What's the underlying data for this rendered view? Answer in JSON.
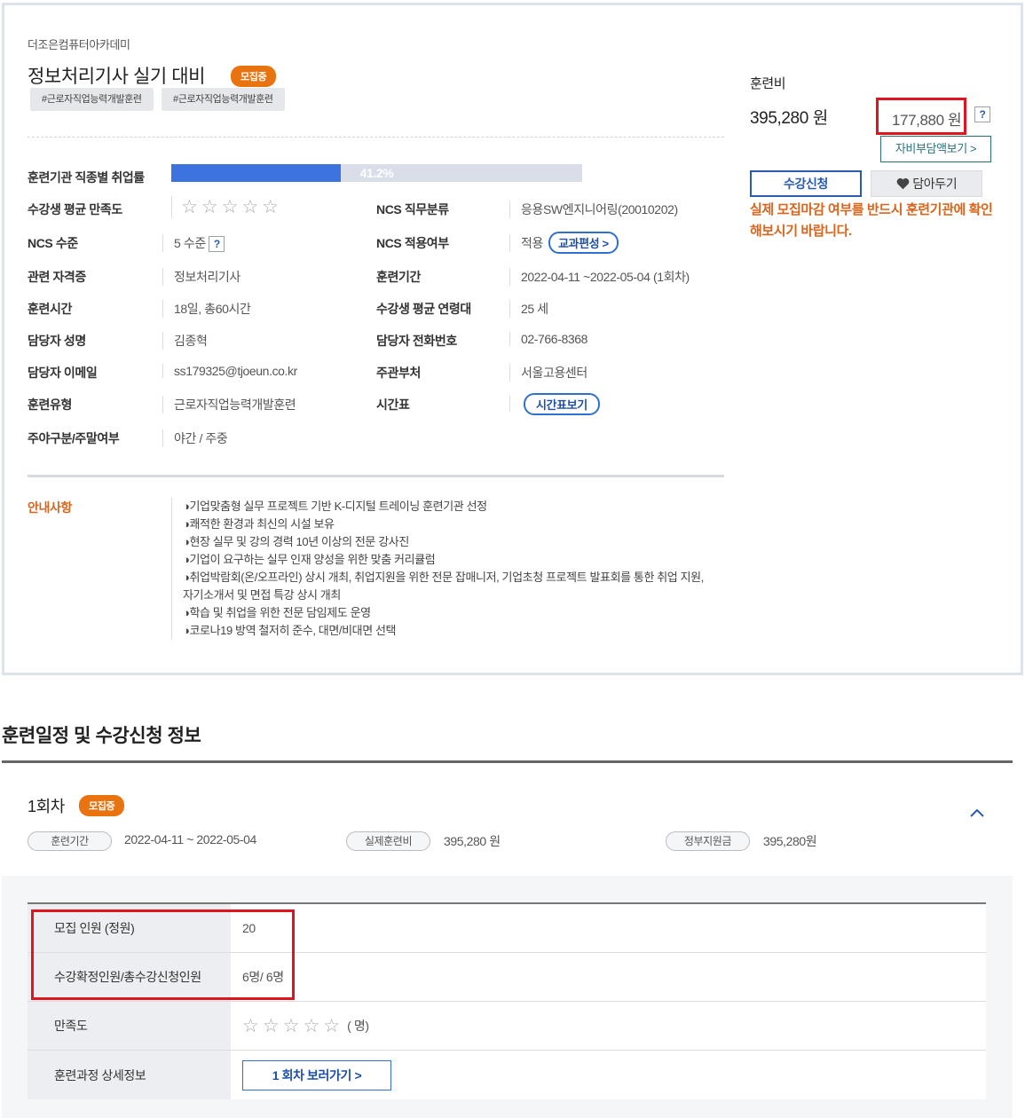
{
  "course": {
    "org": "더조은컴퓨터아카데미",
    "title": "정보처리기사 실기 대비",
    "status_badge": "모집중",
    "tags": [
      "#근로자직업능력개발훈련",
      "#근로자직업능력개발훈련"
    ]
  },
  "details": {
    "employment_label": "훈련기관 직종별 취업률",
    "employment_rate": "41.2%",
    "employment_value": 41.2,
    "satisfaction_label": "수강생 평균 만족도",
    "satisfaction_stars": "☆☆☆☆☆",
    "ncs_job_label": "NCS 직무분류",
    "ncs_job_value": "응용SW엔지니어링(20010202)",
    "ncs_level_label": "NCS 수준",
    "ncs_level_value": "5 수준",
    "help_icon": "?",
    "ncs_apply_label": "NCS 적용여부",
    "ncs_apply_value": "적용",
    "curriculum_button": "교과편성 >",
    "cert_label": "관련 자격증",
    "cert_value": "정보처리기사",
    "period_label": "훈련기간",
    "period_value": "2022-04-11 ~2022-05-04 (1회차)",
    "hours_label": "훈련시간",
    "hours_value": "18일, 총60시간",
    "age_label": "수강생 평균 연령대",
    "age_value": "25 세",
    "manager_label": "담당자 성명",
    "manager_value": "김종혁",
    "phone_label": "담당자 전화번호",
    "phone_value": "02-766-8368",
    "email_label": "담당자 이메일",
    "email_value": "ss179325@tjoeun.co.kr",
    "dept_label": "주관부처",
    "dept_value": "서울고용센터",
    "type_label": "훈련유형",
    "type_value": "근로자직업능력개발훈련",
    "timetable_label": "시간표",
    "timetable_button": "시간표보기",
    "daynight_label": "주야구분/주말여부",
    "daynight_value": "야간 / 주중"
  },
  "notice": {
    "label": "안내사항",
    "items": [
      "◑기업맞춤형 실무 프로젝트 기반 K-디지털 트레이닝 훈련기관 선정",
      "◑쾌적한 환경과 최신의 시설 보유",
      "◑현장 실무 및 강의 경력 10년 이상의 전문 강사진",
      "◑기업이 요구하는 실무 인재 양성을 위한 맞춤 커리큘럼",
      "◑취업박람회(온/오프라인) 상시 개최, 취업지원을 위한 전문 잡매니저, 기업초청 프로젝트 발표회를 통한 취업 지원,",
      "자기소개서 및 면접 특강 상시 개최",
      "◑학습 및 취업을 위한 전문 담임제도 운영",
      "◑코로나19 방역 철저히 준수, 대면/비대면 선택"
    ]
  },
  "fee": {
    "label": "훈련비",
    "full": "395,280 원",
    "self_pay": "177,880 원",
    "help": "?",
    "self_pay_button": "자비부담액보기 >",
    "apply_button": "수강신청",
    "wish_icon": "heart-icon",
    "wish_button": "담아두기",
    "warning": "실제 모집마감 여부를 반드시 훈련기관에 확인해보시기 바랍니다."
  },
  "schedule": {
    "section_title": "훈련일정 및 수강신청 정보",
    "round": "1회차",
    "round_badge": "모집중",
    "chev": "^",
    "period_chip": "훈련기간",
    "period_value": "2022-04-11 ~ 2022-05-04",
    "fee_chip": "실제훈련비",
    "fee_value": "395,280 원",
    "gov_chip": "정부지원금",
    "gov_value": "395,280원",
    "rows": {
      "capacity_label": "모집 인원 (정원)",
      "capacity_value": "20",
      "enroll_label": "수강확정인원/총수강신청인원",
      "enroll_value": "6명/ 6명",
      "satisfaction_label": "만족도",
      "satisfaction_stars": "☆☆☆☆☆",
      "satisfaction_suffix": "( 명)",
      "detail_label": "훈련과정 상세정보",
      "detail_button": "1 회차 보러가기 >"
    }
  },
  "colors": {
    "accent_orange": "#e8730f",
    "bar_blue": "#3d73df",
    "highlight_red": "#e0141e",
    "warn_orange": "#d9651c"
  }
}
